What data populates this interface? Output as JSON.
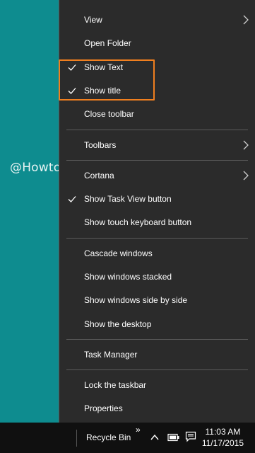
{
  "watermark": "@Howto-connect.com",
  "menu": {
    "items": [
      {
        "label": "View",
        "submenu": true,
        "checked": false
      },
      {
        "label": "Open Folder",
        "submenu": false,
        "checked": false
      },
      {
        "label": "Show Text",
        "submenu": false,
        "checked": true
      },
      {
        "label": "Show title",
        "submenu": false,
        "checked": true
      },
      {
        "label": "Close toolbar",
        "submenu": false,
        "checked": false
      },
      {
        "label": "Toolbars",
        "submenu": true,
        "checked": false
      },
      {
        "label": "Cortana",
        "submenu": true,
        "checked": false
      },
      {
        "label": "Show Task View button",
        "submenu": false,
        "checked": true
      },
      {
        "label": "Show touch keyboard button",
        "submenu": false,
        "checked": false
      },
      {
        "label": "Cascade windows",
        "submenu": false,
        "checked": false
      },
      {
        "label": "Show windows stacked",
        "submenu": false,
        "checked": false
      },
      {
        "label": "Show windows side by side",
        "submenu": false,
        "checked": false
      },
      {
        "label": "Show the desktop",
        "submenu": false,
        "checked": false
      },
      {
        "label": "Task Manager",
        "submenu": false,
        "checked": false
      },
      {
        "label": "Lock the taskbar",
        "submenu": false,
        "checked": false
      },
      {
        "label": "Properties",
        "submenu": false,
        "checked": false
      }
    ]
  },
  "taskbar": {
    "toolbar_label": "Recycle Bin",
    "overflow_glyph": "»",
    "time": "11:03 AM",
    "date": "11/17/2015",
    "icons": [
      "chevron-up-icon",
      "battery-icon",
      "action-center-icon"
    ]
  },
  "colors": {
    "desktop": "#0e8c8f",
    "menu_bg": "#2b2b2b",
    "highlight_border": "#f07f1f",
    "taskbar_bg": "#101010"
  }
}
